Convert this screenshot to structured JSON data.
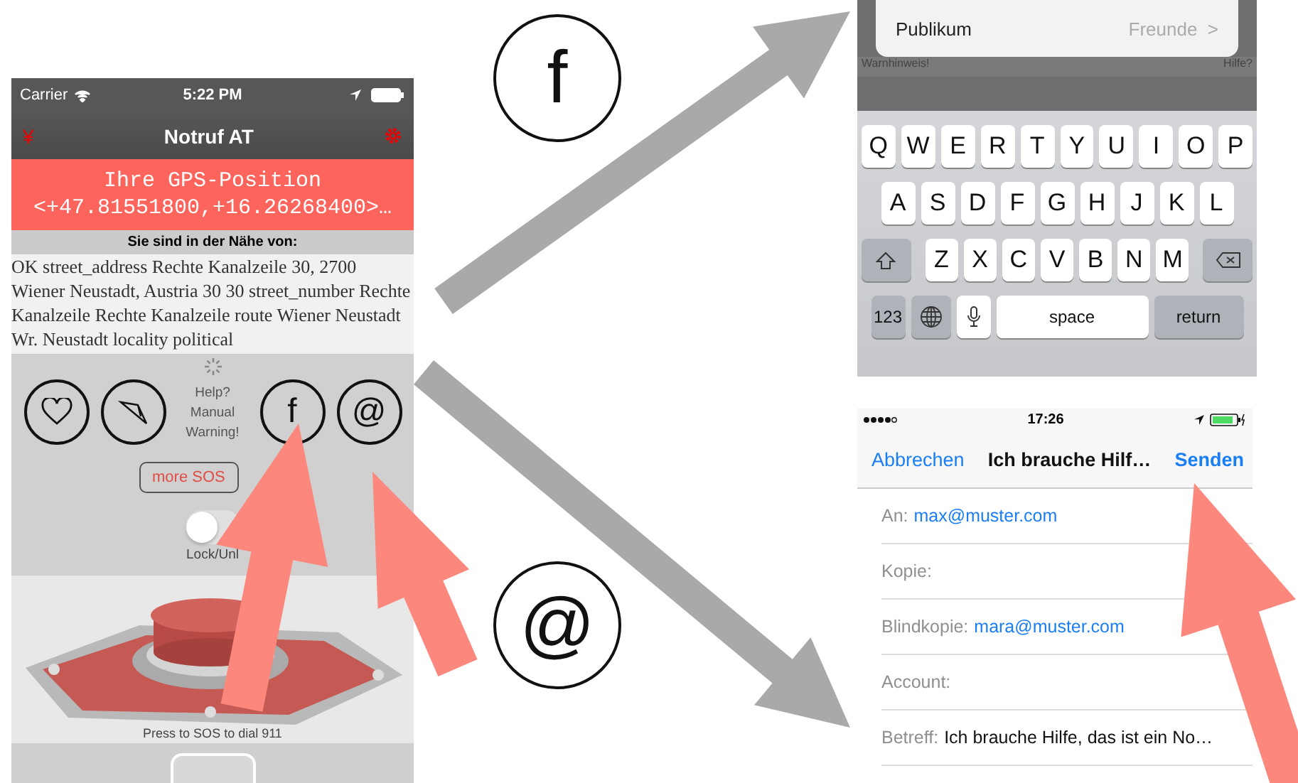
{
  "app_screen": {
    "status_bar": {
      "carrier": "Carrier",
      "time": "5:22 PM"
    },
    "nav": {
      "left_icon": "¥",
      "title": "Notruf AT"
    },
    "gps": {
      "title": "Ihre GPS-Position",
      "coords": "<+47.81551800,+16.26268400>…"
    },
    "nearby_header": "Sie sind in der Nähe von:",
    "address": "OK street_address Rechte Kanalzeile 30, 2700 Wiener Neustadt, Austria 30 30 street_number Rechte Kanalzeile Rechte Kanalzeile route Wiener Neustadt Wr. Neustadt locality political",
    "actions": [
      {
        "kind": "heart"
      },
      {
        "kind": "plane"
      },
      {
        "kind": "text",
        "lines": [
          "Help?",
          "Manual",
          "Warning!"
        ]
      },
      {
        "kind": "label",
        "label": "f"
      },
      {
        "kind": "label",
        "label": "@"
      }
    ],
    "more_button": "more SOS",
    "lock_toggle": {
      "on": false,
      "label": "Lock/Unl"
    },
    "footer": "Press to SOS to dial 911"
  },
  "diagram": {
    "symbols": [
      "f",
      "@"
    ]
  },
  "share_screen": {
    "popup": {
      "label": "Publikum",
      "value": "Freunde",
      "chevron": ">"
    },
    "warning": "Warnhinweis!",
    "help": "Hilfe?",
    "keyboard": [
      [
        {
          "kind": "char",
          "label": "Q"
        },
        {
          "kind": "char",
          "label": "W"
        },
        {
          "kind": "char",
          "label": "E"
        },
        {
          "kind": "char",
          "label": "R"
        },
        {
          "kind": "char",
          "label": "T"
        },
        {
          "kind": "char",
          "label": "Y"
        },
        {
          "kind": "char",
          "label": "U"
        },
        {
          "kind": "char",
          "label": "I"
        },
        {
          "kind": "char",
          "label": "O"
        },
        {
          "kind": "char",
          "label": "P"
        }
      ],
      [
        {
          "kind": "char",
          "label": "A"
        },
        {
          "kind": "char",
          "label": "S"
        },
        {
          "kind": "char",
          "label": "D"
        },
        {
          "kind": "char",
          "label": "F"
        },
        {
          "kind": "char",
          "label": "G"
        },
        {
          "kind": "char",
          "label": "H"
        },
        {
          "kind": "char",
          "label": "J"
        },
        {
          "kind": "char",
          "label": "K"
        },
        {
          "kind": "char",
          "label": "L"
        }
      ],
      [
        {
          "kind": "shift"
        },
        {
          "kind": "char",
          "label": "Z"
        },
        {
          "kind": "char",
          "label": "X"
        },
        {
          "kind": "char",
          "label": "C"
        },
        {
          "kind": "char",
          "label": "V"
        },
        {
          "kind": "char",
          "label": "B"
        },
        {
          "kind": "char",
          "label": "N"
        },
        {
          "kind": "char",
          "label": "M"
        },
        {
          "kind": "delete"
        }
      ],
      [
        {
          "kind": "mode",
          "label": "123"
        },
        {
          "kind": "globe"
        },
        {
          "kind": "mic"
        },
        {
          "kind": "space",
          "label": "space"
        },
        {
          "kind": "return",
          "label": "return"
        }
      ]
    ]
  },
  "mail_screen": {
    "status_bar": {
      "time": "17:26"
    },
    "cancel": "Abbrechen",
    "title": "Ich brauche Hilf…",
    "send": "Senden",
    "fields": [
      {
        "kind": "address",
        "label": "An:",
        "value": "max@muster.com"
      },
      {
        "label": "Kopie:"
      },
      {
        "kind": "address",
        "label": "Blindkopie:",
        "value": "mara@muster.com"
      },
      {
        "label": "Account:"
      },
      {
        "kind": "subject",
        "label": "Betreff:",
        "value": "Ich brauche Hilfe, das ist ein No…"
      }
    ]
  }
}
